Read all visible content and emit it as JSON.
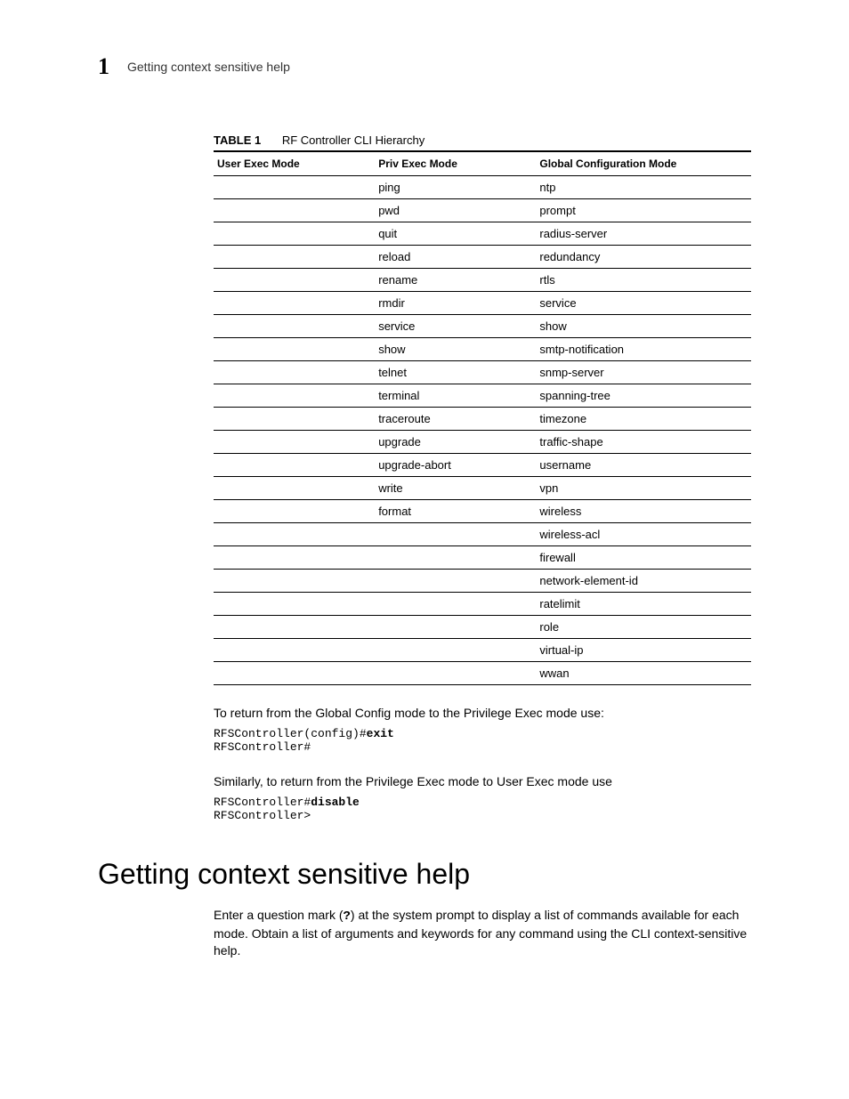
{
  "header": {
    "page_number": "1",
    "running_title": "Getting context sensitive help"
  },
  "table": {
    "label": "TABLE 1",
    "title": "RF Controller CLI Hierarchy",
    "columns": [
      "User Exec Mode",
      "Priv Exec Mode",
      "Global Configuration Mode"
    ],
    "rows": [
      [
        "",
        "ping",
        "ntp"
      ],
      [
        "",
        "pwd",
        "prompt"
      ],
      [
        "",
        "quit",
        "radius-server"
      ],
      [
        "",
        "reload",
        "redundancy"
      ],
      [
        "",
        "rename",
        "rtls"
      ],
      [
        "",
        "rmdir",
        "service"
      ],
      [
        "",
        "service",
        "show"
      ],
      [
        "",
        "show",
        "smtp-notification"
      ],
      [
        "",
        "telnet",
        "snmp-server"
      ],
      [
        "",
        "terminal",
        "spanning-tree"
      ],
      [
        "",
        "traceroute",
        "timezone"
      ],
      [
        "",
        "upgrade",
        "traffic-shape"
      ],
      [
        "",
        "upgrade-abort",
        "username"
      ],
      [
        "",
        "write",
        "vpn"
      ],
      [
        "",
        "format",
        "wireless"
      ],
      [
        "",
        "",
        "wireless-acl"
      ],
      [
        "",
        "",
        "firewall"
      ],
      [
        "",
        "",
        "network-element-id"
      ],
      [
        "",
        "",
        "ratelimit"
      ],
      [
        "",
        "",
        "role"
      ],
      [
        "",
        "",
        "virtual-ip"
      ],
      [
        "",
        "",
        "wwan"
      ]
    ]
  },
  "paragraphs": {
    "p1": "To return from the Global Config mode to the Privilege Exec mode use:",
    "code1_prefix": "RFSController(config)#",
    "code1_bold": "exit",
    "code1_line2": "RFSController#",
    "p2": "Similarly, to return from the Privilege Exec mode to User Exec mode use",
    "code2_prefix": "RFSController#",
    "code2_bold": "disable",
    "code2_line2": "RFSController>"
  },
  "section": {
    "heading": "Getting context sensitive help",
    "body_a": "Enter a question mark (",
    "body_bold": "?",
    "body_b": ") at the system prompt to display a list of commands available for each mode. Obtain a list of arguments and keywords for any command using the CLI context-sensitive help."
  }
}
